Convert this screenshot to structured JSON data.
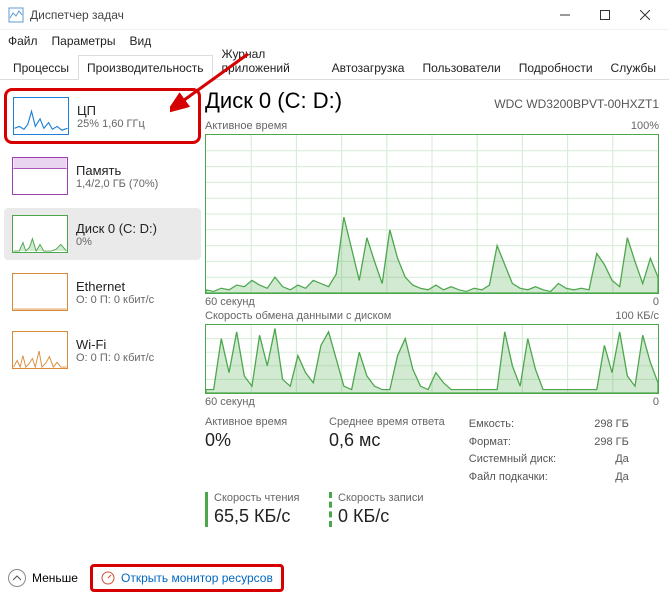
{
  "window": {
    "title": "Диспетчер задач"
  },
  "menu": {
    "file": "Файл",
    "options": "Параметры",
    "view": "Вид"
  },
  "tabs": {
    "processes": "Процессы",
    "performance": "Производительность",
    "apphistory": "Журнал приложений",
    "startup": "Автозагрузка",
    "users": "Пользователи",
    "details": "Подробности",
    "services": "Службы"
  },
  "sidebar": {
    "cpu": {
      "title": "ЦП",
      "sub": "25% 1,60 ГГц"
    },
    "memory": {
      "title": "Память",
      "sub": "1,4/2,0 ГБ (70%)"
    },
    "disk": {
      "title": "Диск 0 (C: D:)",
      "sub": "0%"
    },
    "ethernet": {
      "title": "Ethernet",
      "sub": "О: 0 П: 0 кбит/с"
    },
    "wifi": {
      "title": "Wi-Fi",
      "sub": "О: 0 П: 0 кбит/с"
    }
  },
  "main": {
    "title": "Диск 0 (C: D:)",
    "model": "WDC WD3200BPVT-00HXZT1",
    "active_time_label": "Активное время",
    "active_max": "100%",
    "time_axis_left": "60 секунд",
    "time_axis_right": "0",
    "throughput_label": "Скорость обмена данными с диском",
    "throughput_max": "100 КБ/с"
  },
  "stats": {
    "active_time_label": "Активное время",
    "active_time_value": "0%",
    "avg_response_label": "Среднее время ответа",
    "avg_response_value": "0,6 мс",
    "read_label": "Скорость чтения",
    "read_value": "65,5 КБ/с",
    "write_label": "Скорость записи",
    "write_value": "0 КБ/с"
  },
  "info": {
    "capacity_label": "Емкость:",
    "capacity_value": "298 ГБ",
    "formatted_label": "Формат:",
    "formatted_value": "298 ГБ",
    "system_disk_label": "Системный диск:",
    "system_disk_value": "Да",
    "pagefile_label": "Файл подкачки:",
    "pagefile_value": "Да"
  },
  "footer": {
    "less": "Меньше",
    "open_rm": "Открыть монитор ресурсов"
  },
  "chart_data": [
    {
      "type": "area",
      "title": "Активное время",
      "ylabel": "%",
      "ylim": [
        0,
        100
      ],
      "x_range_seconds": [
        60,
        0
      ],
      "values": [
        2,
        1,
        3,
        2,
        5,
        4,
        8,
        5,
        3,
        10,
        4,
        2,
        5,
        3,
        8,
        6,
        4,
        12,
        48,
        28,
        8,
        35,
        20,
        6,
        40,
        22,
        10,
        5,
        3,
        2,
        5,
        2,
        4,
        2,
        1,
        3,
        2,
        5,
        30,
        18,
        6,
        3,
        2,
        4,
        2,
        1,
        6,
        3,
        2,
        3,
        2,
        25,
        18,
        8,
        4,
        35,
        20,
        6,
        22,
        10
      ]
    },
    {
      "type": "area",
      "title": "Скорость обмена данными с диском",
      "ylabel": "КБ/с",
      "ylim": [
        0,
        100
      ],
      "x_range_seconds": [
        60,
        0
      ],
      "values": [
        5,
        5,
        80,
        30,
        90,
        25,
        10,
        85,
        40,
        95,
        20,
        10,
        55,
        30,
        15,
        70,
        90,
        50,
        10,
        5,
        60,
        25,
        10,
        5,
        5,
        55,
        80,
        35,
        10,
        5,
        30,
        15,
        5,
        5,
        5,
        5,
        5,
        5,
        5,
        90,
        40,
        10,
        80,
        35,
        5,
        5,
        5,
        5,
        5,
        5,
        5,
        5,
        70,
        30,
        90,
        25,
        10,
        85,
        45,
        15
      ]
    }
  ]
}
